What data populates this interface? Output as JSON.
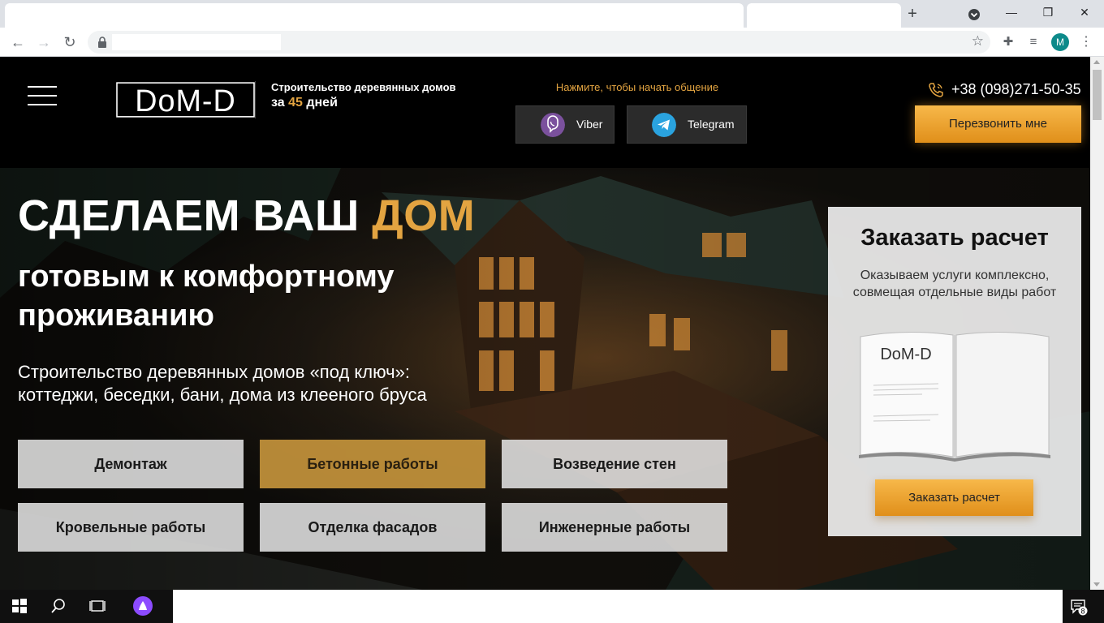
{
  "browser": {
    "new_tab": "+",
    "win_minimize": "—",
    "win_restore": "❐",
    "win_close": "✕",
    "avatar_letter": "M"
  },
  "header": {
    "tagline_line1": "Строительство деревянных домов",
    "tagline_prefix": "за",
    "tagline_days": "45",
    "tagline_suffix": "дней",
    "chat_prompt": "Нажмите, чтобы начать общение",
    "viber_label": "Viber",
    "telegram_label": "Telegram",
    "phone": "+38 (098)271-50-35",
    "callback_label": "Перезвонить мне"
  },
  "hero": {
    "title_white": "СДЕЛАЕМ ВАШ",
    "title_accent": "ДОМ",
    "subtitle": "готовым к комфортному проживанию",
    "lead_line1": "Строительство деревянных домов «под ключ»:",
    "lead_line2": "коттеджи, беседки, бани, дома из клееного бруса",
    "services": [
      {
        "label": "Демонтаж",
        "active": false
      },
      {
        "label": "Бетонные работы",
        "active": true
      },
      {
        "label": "Возведение стен",
        "active": false
      },
      {
        "label": "Кровельные работы",
        "active": false
      },
      {
        "label": "Отделка фасадов",
        "active": false
      },
      {
        "label": "Инженерные работы",
        "active": false
      }
    ]
  },
  "order_card": {
    "title": "Заказать расчет",
    "subtitle_line1": "Оказываем услуги комплексно,",
    "subtitle_line2": "совмещая отдельные виды работ",
    "button_label": "Заказать расчет"
  },
  "taskbar": {
    "notification_count": "8"
  },
  "colors": {
    "accent": "#e3a441",
    "button_gradient_top": "#f7b84a",
    "button_gradient_bottom": "#e08f1a",
    "viber": "#7b519d",
    "telegram": "#2aa3df"
  }
}
